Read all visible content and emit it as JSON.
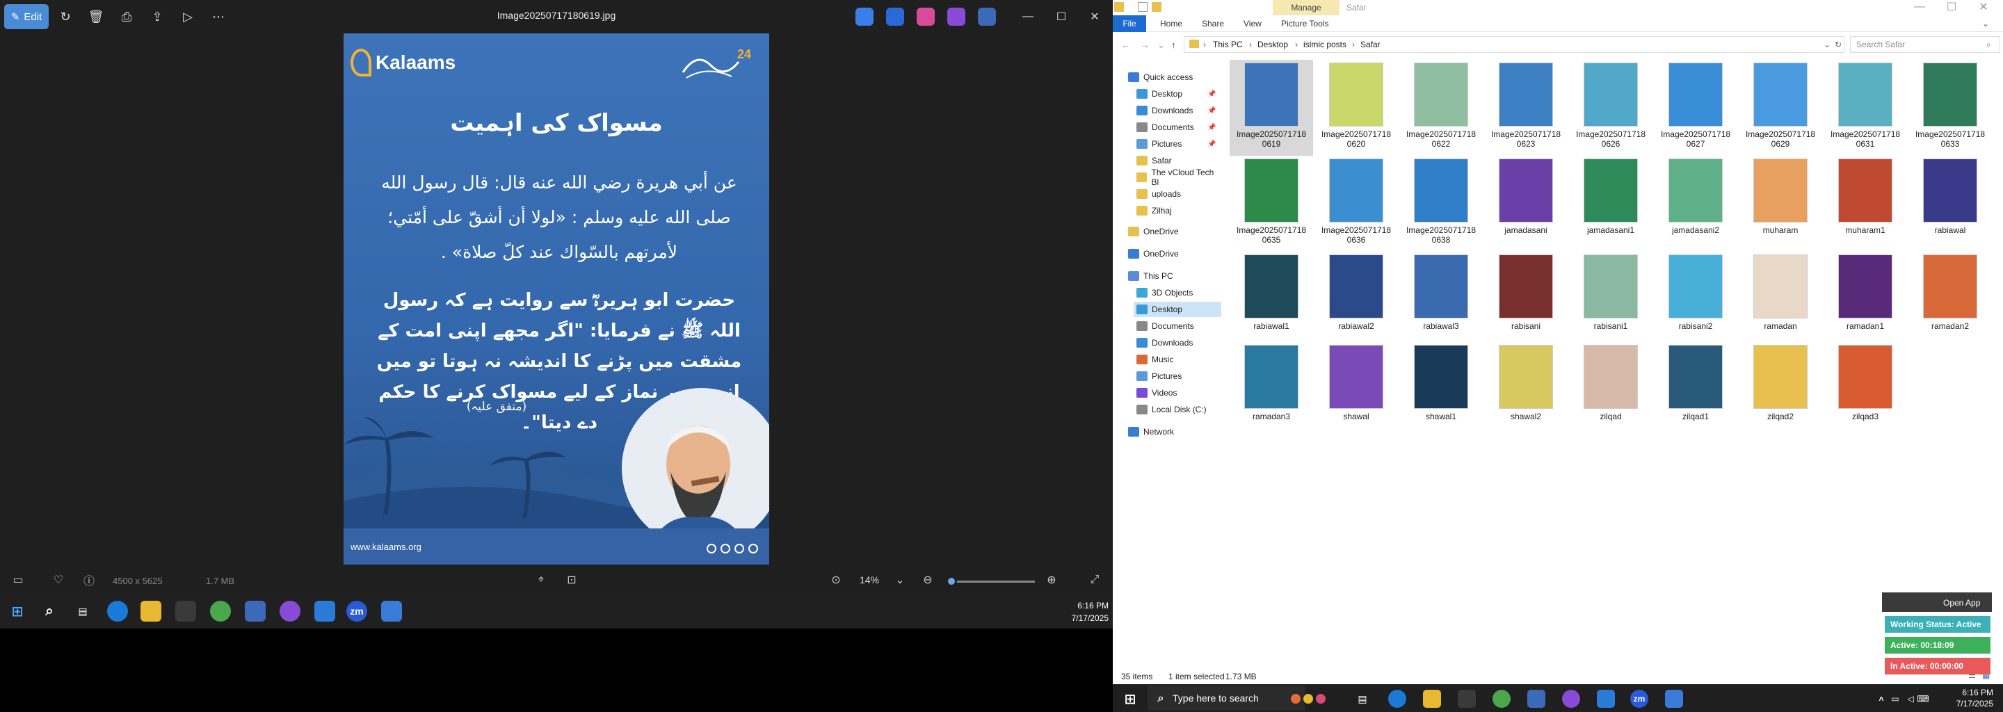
{
  "photos": {
    "edit_label": "Edit",
    "file_title": "Image20250717180619.jpg",
    "image_dimensions": "4500 x 5625",
    "file_size": "1.7 MB",
    "zoom_level": "14%",
    "zoom_fraction": 0.02
  },
  "post": {
    "brand": "Kalaams",
    "seal_number": "24",
    "heading": "مسواک کی اہمیت",
    "arabic": "عن أبي هريرة رضي الله عنه قال: قال رسول الله صلى الله عليه وسلم : «لولا أن أشقّ على أمّتي؛ لأمرتهم بالسّواك عند كلّ صلاة» .",
    "urdu": "حضرت ابو ہریرہؓ سے روایت ہے کہ رسول اللہ ﷺ نے فرمایا: \"اگر مجھے اپنی امت کے مشقت میں پڑنے کا اندیشہ نہ ہوتا تو میں انہیں ہر نماز کے لیے مسواک کرنے کا حکم دے دیتا\"۔",
    "reference": "(متفق علیہ)",
    "url": "www.kalaams.org"
  },
  "taskbar_inner": {
    "time": "6:16 PM",
    "date": "7/17/2025"
  },
  "explorer": {
    "manage_label": "Manage",
    "title": "Safar",
    "tabs": [
      "File",
      "Home",
      "Share",
      "View",
      "Picture Tools"
    ],
    "breadcrumb": [
      "This PC",
      "Desktop",
      "islmic posts",
      "Safar"
    ],
    "search_placeholder": "Search Safar",
    "sidebar": [
      {
        "label": "Quick access",
        "pinned": false
      },
      {
        "label": "Desktop",
        "pinned": true
      },
      {
        "label": "Downloads",
        "pinned": true
      },
      {
        "label": "Documents",
        "pinned": true
      },
      {
        "label": "Pictures",
        "pinned": true
      },
      {
        "label": "Safar",
        "pinned": false
      },
      {
        "label": "The vCloud Tech Bl",
        "pinned": false
      },
      {
        "label": "uploads",
        "pinned": false
      },
      {
        "label": "Zilhaj",
        "pinned": false
      },
      {
        "label": "OneDrive",
        "pinned": false
      },
      {
        "label": "OneDrive",
        "pinned": false
      },
      {
        "label": "This PC",
        "pinned": false
      },
      {
        "label": "3D Objects",
        "pinned": false
      },
      {
        "label": "Desktop",
        "pinned": false
      },
      {
        "label": "Documents",
        "pinned": false
      },
      {
        "label": "Downloads",
        "pinned": false
      },
      {
        "label": "Music",
        "pinned": false
      },
      {
        "label": "Pictures",
        "pinned": false
      },
      {
        "label": "Videos",
        "pinned": false
      },
      {
        "label": "Local Disk (C:)",
        "pinned": false
      },
      {
        "label": "Network",
        "pinned": false
      }
    ],
    "files": [
      {
        "name": "Image2025071718 0619",
        "color": "#3d73b8"
      },
      {
        "name": "Image2025071718 0620",
        "color": "#c9d86a"
      },
      {
        "name": "Image2025071718 0622",
        "color": "#8fbfa0"
      },
      {
        "name": "Image2025071718 0623",
        "color": "#3d80c4"
      },
      {
        "name": "Image2025071718 0626",
        "color": "#52a8c8"
      },
      {
        "name": "Image2025071718 0627",
        "color": "#3a8ed8"
      },
      {
        "name": "Image2025071718 0629",
        "color": "#4a9ae0"
      },
      {
        "name": "Image2025071718 0631",
        "color": "#5ab0c0"
      },
      {
        "name": "Image2025071718 0633",
        "color": "#2f7a5a"
      },
      {
        "name": "Image2025071718 0635",
        "color": "#2e8a4a"
      },
      {
        "name": "Image2025071718 0636",
        "color": "#3b8ed0"
      },
      {
        "name": "Image2025071718 0638",
        "color": "#2f7fc8"
      },
      {
        "name": "jamadasani",
        "color": "#6b3fa8"
      },
      {
        "name": "jamadasani1",
        "color": "#2f8a5a"
      },
      {
        "name": "jamadasani2",
        "color": "#5fb088"
      },
      {
        "name": "muharam",
        "color": "#e8a060"
      },
      {
        "name": "muharam1",
        "color": "#c04a30"
      },
      {
        "name": "rabiawal",
        "color": "#3a3a8a"
      },
      {
        "name": "rabiawal1",
        "color": "#1f4a5a"
      },
      {
        "name": "rabiawal2",
        "color": "#2a4a8a"
      },
      {
        "name": "rabiawal3",
        "color": "#3a6ab0"
      },
      {
        "name": "rabisani",
        "color": "#7a2f2f"
      },
      {
        "name": "rabisani1",
        "color": "#8ab8a0"
      },
      {
        "name": "rabisani2",
        "color": "#48b0d8"
      },
      {
        "name": "ramadan",
        "color": "#e8d8c8"
      },
      {
        "name": "ramadan1",
        "color": "#5a2a7a"
      },
      {
        "name": "ramadan2",
        "color": "#d86a3a"
      },
      {
        "name": "ramadan3",
        "color": "#2a7aa0"
      },
      {
        "name": "shawal",
        "color": "#7a4ab8"
      },
      {
        "name": "shawal1",
        "color": "#1a3a5a"
      },
      {
        "name": "shawal2",
        "color": "#d8c860"
      },
      {
        "name": "zilqad",
        "color": "#d8b8a8"
      },
      {
        "name": "zilqad1",
        "color": "#2a5a7a"
      },
      {
        "name": "zilqad2",
        "color": "#e8c050"
      },
      {
        "name": "zilqad3",
        "color": "#d85a30"
      }
    ],
    "status_items": "35 items",
    "status_selected": "1 item selected",
    "status_size": "1.73 MB"
  },
  "work_widget": {
    "open_app": "Open App",
    "status": "Working Status: Active",
    "active": "Active: 00:18:09",
    "inactive": "In Active: 00:00:00"
  },
  "taskbar": {
    "search_placeholder": "Type here to search",
    "time": "6:16 PM",
    "date": "7/17/2025"
  }
}
